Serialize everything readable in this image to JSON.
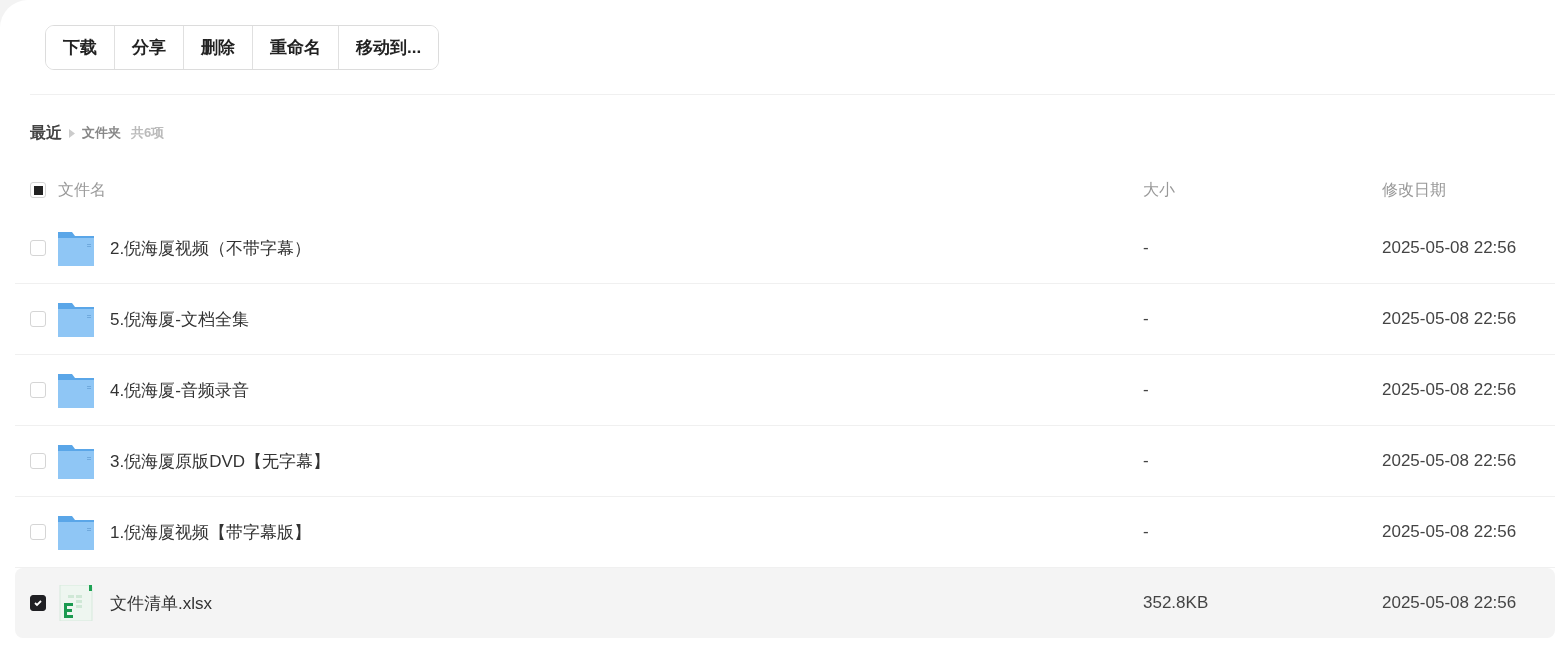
{
  "toolbar": [
    {
      "label": "下载"
    },
    {
      "label": "分享"
    },
    {
      "label": "删除"
    },
    {
      "label": "重命名"
    },
    {
      "label": "移动到..."
    }
  ],
  "breadcrumb": {
    "root": "最近",
    "current": "文件夹",
    "count": "共6项"
  },
  "table": {
    "select_all": {
      "indeterminate": true
    },
    "columns": [
      "文件名",
      "大小",
      "修改日期"
    ],
    "rows": [
      {
        "kind": "folder",
        "name": "2.倪海厦视频（不带字幕）",
        "size": "-",
        "modified": "2025-05-08 22:56",
        "selected": false
      },
      {
        "kind": "folder",
        "name": "5.倪海厦-文档全集",
        "size": "-",
        "modified": "2025-05-08 22:56",
        "selected": false
      },
      {
        "kind": "folder",
        "name": "4.倪海厦-音频录音",
        "size": "-",
        "modified": "2025-05-08 22:56",
        "selected": false
      },
      {
        "kind": "folder",
        "name": "3.倪海厦原版DVD【无字幕】",
        "size": "-",
        "modified": "2025-05-08 22:56",
        "selected": false
      },
      {
        "kind": "folder",
        "name": "1.倪海厦视频【带字幕版】",
        "size": "-",
        "modified": "2025-05-08 22:56",
        "selected": false
      },
      {
        "kind": "spreadsheet",
        "name": "文件清单.xlsx",
        "size": "352.8KB",
        "modified": "2025-05-08 22:56",
        "selected": true
      }
    ]
  }
}
